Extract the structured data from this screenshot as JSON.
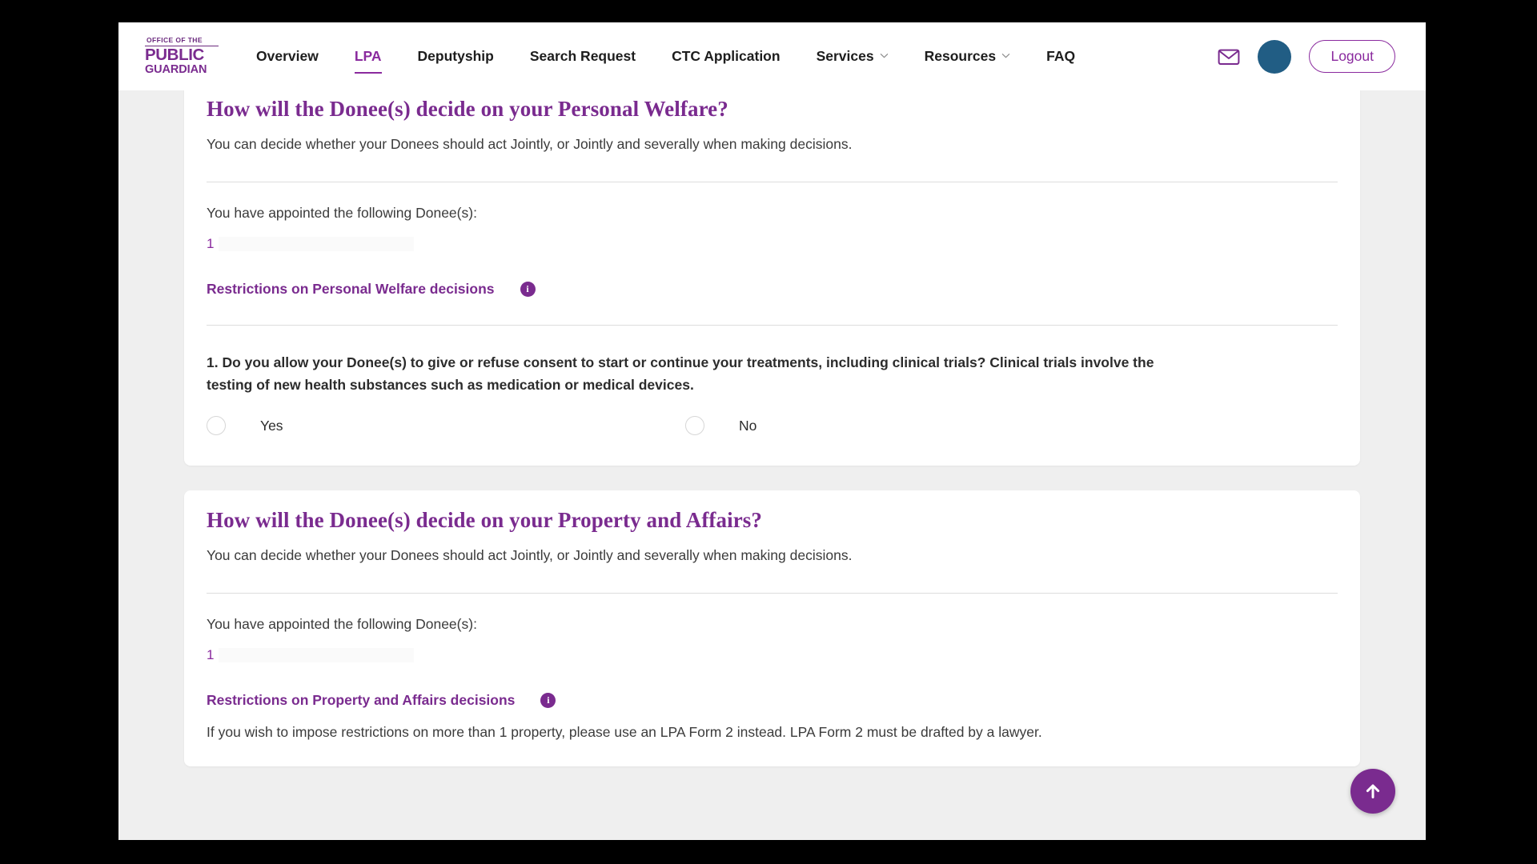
{
  "nav": {
    "logo": {
      "line1": "OFFICE OF THE",
      "line2": "PUBLIC",
      "line3": "GUARDIAN",
      "icon": "public-guardian-logo"
    },
    "items": [
      {
        "label": "Overview",
        "active": false,
        "has_dropdown": false
      },
      {
        "label": "LPA",
        "active": true,
        "has_dropdown": false
      },
      {
        "label": "Deputyship",
        "active": false,
        "has_dropdown": false
      },
      {
        "label": "Search Request",
        "active": false,
        "has_dropdown": false
      },
      {
        "label": "CTC Application",
        "active": false,
        "has_dropdown": false
      },
      {
        "label": "Services",
        "active": false,
        "has_dropdown": true
      },
      {
        "label": "Resources",
        "active": false,
        "has_dropdown": true
      },
      {
        "label": "FAQ",
        "active": false,
        "has_dropdown": false
      }
    ],
    "mail_icon": "envelope-icon",
    "avatar_icon": "user-avatar",
    "logout_label": "Logout",
    "accent_color": "#8a2a9e",
    "avatar_color": "#215d84"
  },
  "welfare_section": {
    "title": "How will the Donee(s) decide on your Personal Welfare?",
    "description": "You can decide whether your Donees should act Jointly, or Jointly and severally when making decisions.",
    "appointed_label": "You have appointed the following Donee(s):",
    "donees": [
      {
        "index": "1",
        "name": ""
      }
    ],
    "restrictions_title": "Restrictions on Personal Welfare decisions",
    "info_glyph": "i",
    "question": "1. Do you allow your Donee(s) to give or refuse consent to start or continue your treatments, including clinical trials? Clinical trials involve the testing of new health substances such as medication or medical devices.",
    "options": [
      {
        "label": "Yes",
        "selected": false
      },
      {
        "label": "No",
        "selected": false
      }
    ]
  },
  "property_section": {
    "title": "How will the Donee(s) decide on your Property and Affairs?",
    "description": "You can decide whether your Donees should act Jointly, or Jointly and severally when making decisions.",
    "appointed_label": "You have appointed the following Donee(s):",
    "donees": [
      {
        "index": "1",
        "name": ""
      }
    ],
    "restrictions_title": "Restrictions on Property and Affairs decisions",
    "info_glyph": "i",
    "note": "If you wish to impose restrictions on more than 1 property, please use an LPA Form 2 instead. LPA Form 2 must be drafted by a lawyer."
  },
  "scroll_top": {
    "icon": "arrow-up-icon",
    "color": "#7a2b8f"
  }
}
